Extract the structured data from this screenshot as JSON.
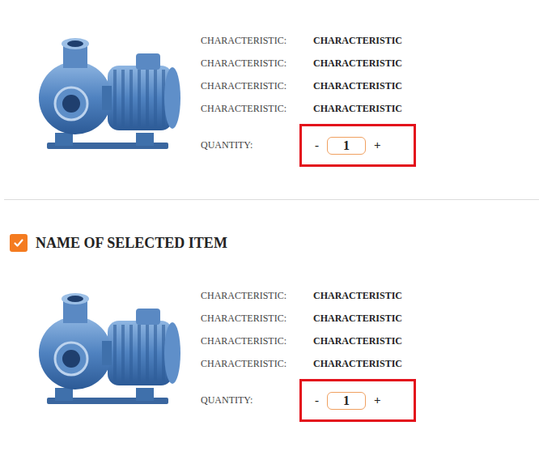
{
  "items": [
    {
      "characteristics": [
        {
          "label": "CHARACTERISTIC:",
          "value": "CHARACTERISTIC"
        },
        {
          "label": "CHARACTERISTIC:",
          "value": "CHARACTERISTIC"
        },
        {
          "label": "CHARACTERISTIC:",
          "value": "CHARACTERISTIC"
        },
        {
          "label": "CHARACTERISTIC:",
          "value": "CHARACTERISTIC"
        }
      ],
      "quantity": {
        "label": "QUANTITY:",
        "minus": "-",
        "value": "1",
        "plus": "+",
        "highlighted": true
      }
    },
    {
      "name": "NAME OF SELECTED ITEM",
      "checked": true,
      "characteristics": [
        {
          "label": "CHARACTERISTIC:",
          "value": "CHARACTERISTIC"
        },
        {
          "label": "CHARACTERISTIC:",
          "value": "CHARACTERISTIC"
        },
        {
          "label": "CHARACTERISTIC:",
          "value": "CHARACTERISTIC"
        },
        {
          "label": "CHARACTERISTIC:",
          "value": "CHARACTERISTIC"
        }
      ],
      "quantity": {
        "label": "QUANTITY:",
        "minus": "-",
        "value": "1",
        "plus": "+",
        "highlighted": true
      }
    }
  ]
}
